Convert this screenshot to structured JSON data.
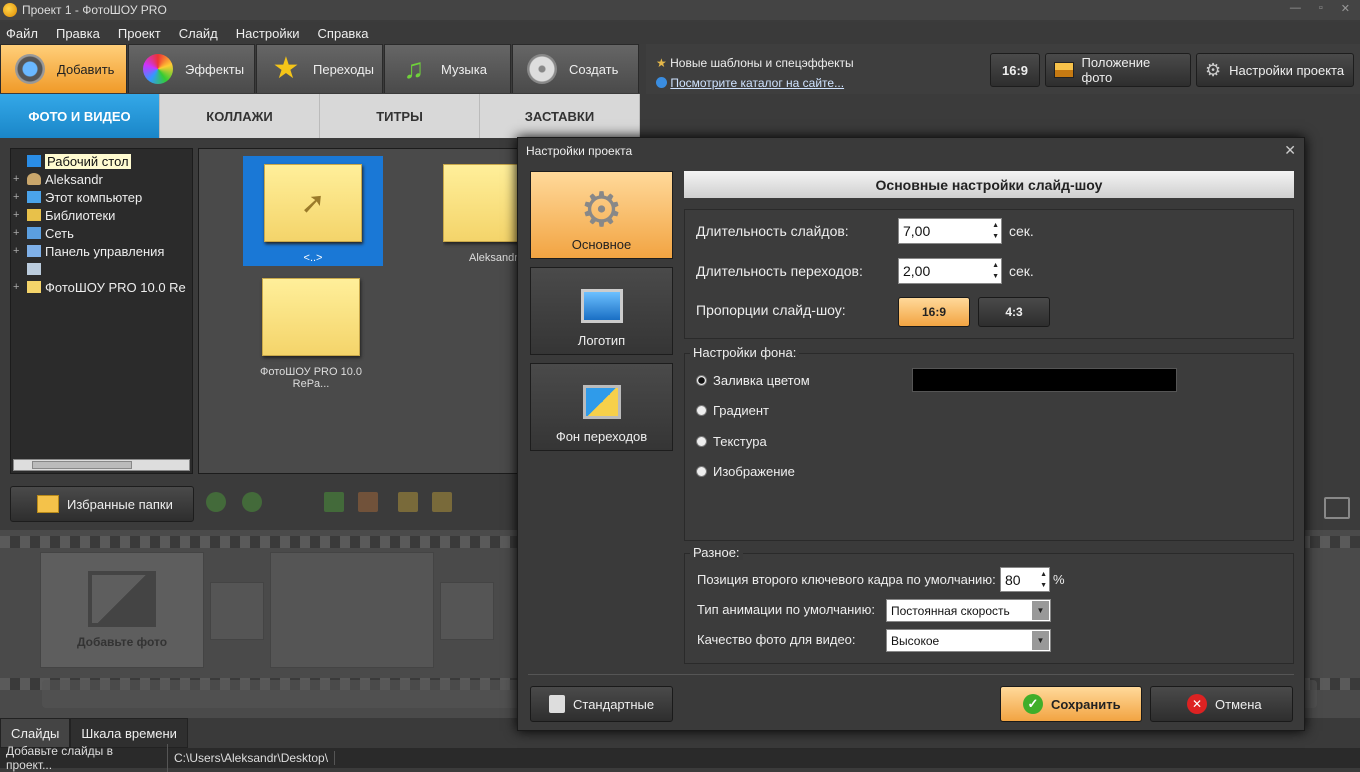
{
  "window": {
    "title": "Проект 1 - ФотоШОУ PRO",
    "controls": [
      "—",
      "▫",
      "✕"
    ]
  },
  "menu": [
    "Файл",
    "Правка",
    "Проект",
    "Слайд",
    "Настройки",
    "Справка"
  ],
  "main_tabs": [
    {
      "label": "Добавить",
      "icon": "camera-icon",
      "active": true
    },
    {
      "label": "Эффекты",
      "icon": "palette-icon"
    },
    {
      "label": "Переходы",
      "icon": "star-icon"
    },
    {
      "label": "Музыка",
      "icon": "music-note-icon"
    },
    {
      "label": "Создать",
      "icon": "film-reel-icon"
    }
  ],
  "news": {
    "text": "Новые шаблоны и спецэффекты",
    "link": "Посмотрите каталог на сайте..."
  },
  "top_buttons": {
    "ratio": "16:9",
    "photo_position": "Положение фото",
    "project_settings": "Настройки проекта"
  },
  "sub_tabs": [
    "ФОТО И ВИДЕО",
    "КОЛЛАЖИ",
    "ТИТРЫ",
    "ЗАСТАВКИ"
  ],
  "tree": [
    {
      "label": "Рабочий стол",
      "expand": "",
      "selected": true
    },
    {
      "label": "Aleksandr",
      "expand": "+"
    },
    {
      "label": "Этот компьютер",
      "expand": "+"
    },
    {
      "label": "Библиотеки",
      "expand": "+"
    },
    {
      "label": "Сеть",
      "expand": "+"
    },
    {
      "label": "Панель управления",
      "expand": "+"
    },
    {
      "label": "",
      "expand": ""
    },
    {
      "label": "ФотоШОУ PRO 10.0 Re",
      "expand": "+"
    }
  ],
  "files": [
    {
      "label": "<..>",
      "selected": true
    },
    {
      "label": "Aleksandr"
    },
    {
      "label": "ФотоШОУ PRO 10.0 RePa..."
    }
  ],
  "favorites_button": "Избранные папки",
  "filmstrip": {
    "add_photo": "Добавьте фото"
  },
  "bottom_tabs": [
    "Слайды",
    "Шкала времени"
  ],
  "status": {
    "left": "Добавьте слайды в проект...",
    "path": "C:\\Users\\Aleksandr\\Desktop\\"
  },
  "dialog": {
    "title": "Настройки проекта",
    "close": "✕",
    "side": [
      "Основное",
      "Логотип",
      "Фон переходов"
    ],
    "header": "Основные настройки слайд-шоу",
    "slide_duration_label": "Длительность слайдов:",
    "slide_duration": "7,00",
    "transition_duration_label": "Длительность переходов:",
    "transition_duration": "2,00",
    "sec": "сек.",
    "aspect_label": "Пропорции слайд-шоу:",
    "aspect_options": [
      "16:9",
      "4:3"
    ],
    "bg_title": "Настройки фона:",
    "bg_options": [
      "Заливка цветом",
      "Градиент",
      "Текстура",
      "Изображение"
    ],
    "bg_color": "#000000",
    "misc_title": "Разное:",
    "keyframe_label": "Позиция второго ключевого кадра по умолчанию:",
    "keyframe_value": "80",
    "percent": "%",
    "anim_label": "Тип анимации по умолчанию:",
    "anim_value": "Постоянная скорость",
    "quality_label": "Качество фото для видео:",
    "quality_value": "Высокое",
    "btn_default": "Стандартные",
    "btn_save": "Сохранить",
    "btn_cancel": "Отмена"
  },
  "colors": {
    "accent_orange": "#f2a442",
    "accent_blue": "#1a86c8"
  }
}
